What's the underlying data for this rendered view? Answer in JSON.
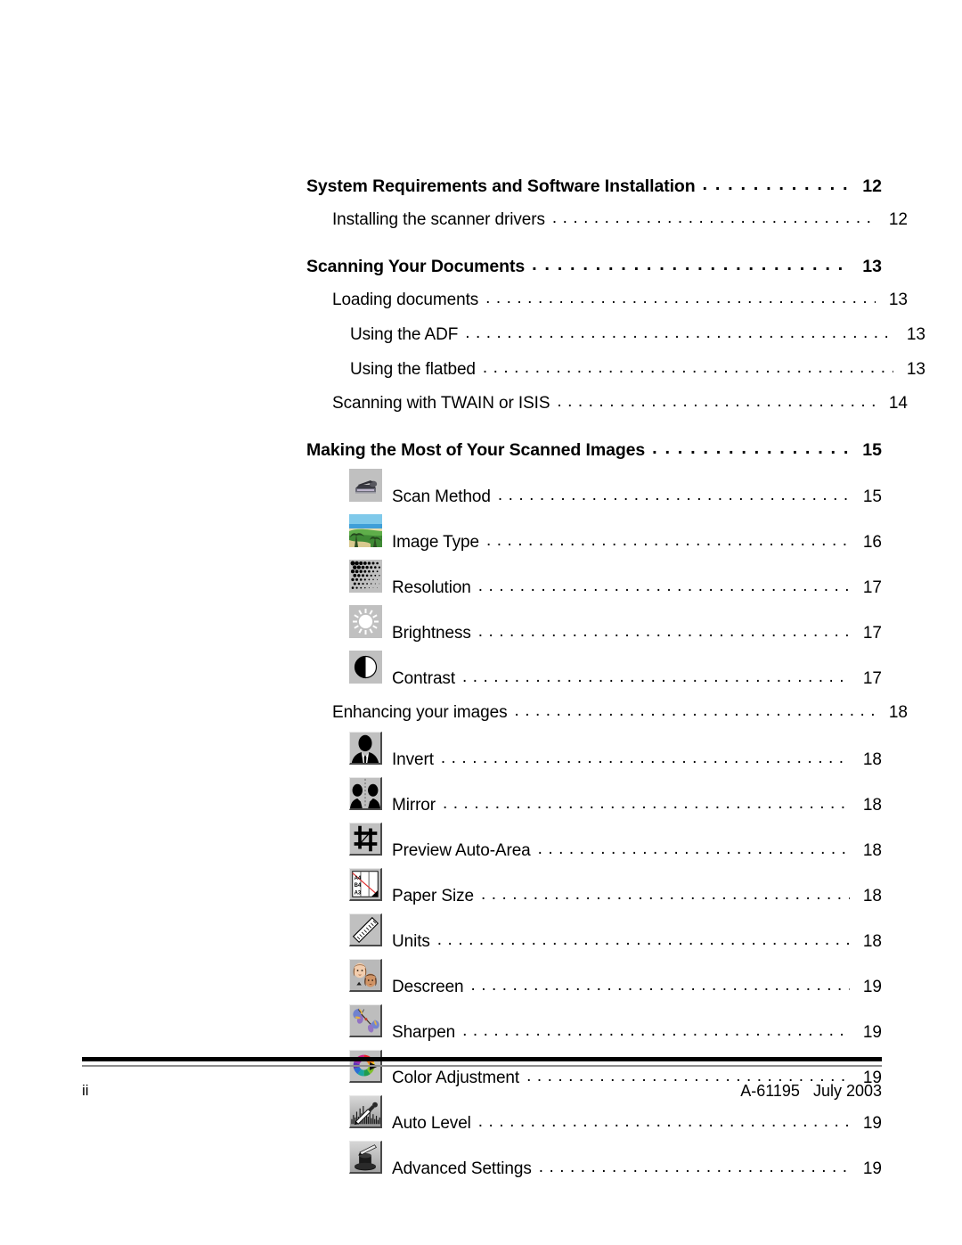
{
  "document": {
    "type": "table-of-contents",
    "page_label": "ii",
    "footer_reference": "A-61195   July 2003"
  },
  "toc": {
    "entries": [
      {
        "level": 1,
        "label": "System Requirements and Software Installation",
        "page": "12",
        "icon": null
      },
      {
        "level": 2,
        "label": "Installing the scanner drivers",
        "page": "12",
        "icon": null
      },
      {
        "level": 1,
        "label": "Scanning Your Documents",
        "page": "13",
        "icon": null
      },
      {
        "level": 2,
        "label": "Loading documents",
        "page": "13",
        "icon": null
      },
      {
        "level": 3,
        "label": "Using the ADF",
        "page": "13",
        "icon": null
      },
      {
        "level": 3,
        "label": "Using the flatbed",
        "page": "13",
        "icon": null
      },
      {
        "level": 2,
        "label": "Scanning with TWAIN or ISIS",
        "page": "14",
        "icon": null
      },
      {
        "level": 1,
        "label": "Making the Most of Your Scanned Images",
        "page": "15",
        "icon": null
      },
      {
        "level": 4,
        "label": "Scan Method",
        "page": "15",
        "icon": "scanner-icon"
      },
      {
        "level": 4,
        "label": "Image Type",
        "page": "16",
        "icon": "landscape-photo-icon"
      },
      {
        "level": 4,
        "label": "Resolution",
        "page": "17",
        "icon": "halftone-dots-icon"
      },
      {
        "level": 4,
        "label": "Brightness",
        "page": "17",
        "icon": "sun-icon"
      },
      {
        "level": 4,
        "label": "Contrast",
        "page": "17",
        "icon": "half-circle-icon"
      },
      {
        "level": 2,
        "label": "Enhancing your images",
        "page": "18",
        "icon": null
      },
      {
        "level": 4,
        "label": "Invert",
        "page": "18",
        "icon": "silhouette-bust-icon"
      },
      {
        "level": 4,
        "label": "Mirror",
        "page": "18",
        "icon": "mirrored-busts-icon"
      },
      {
        "level": 4,
        "label": "Preview Auto-Area",
        "page": "18",
        "icon": "crop-tool-icon"
      },
      {
        "level": 4,
        "label": "Paper Size",
        "page": "18",
        "icon": "paper-sizes-icon"
      },
      {
        "level": 4,
        "label": "Units",
        "page": "18",
        "icon": "ruler-icon"
      },
      {
        "level": 4,
        "label": "Descreen",
        "page": "19",
        "icon": "two-faces-icon"
      },
      {
        "level": 4,
        "label": "Sharpen",
        "page": "19",
        "icon": "butterfly-icon"
      },
      {
        "level": 4,
        "label": "Color Adjustment",
        "page": "19",
        "icon": "color-wheel-icon"
      },
      {
        "level": 4,
        "label": "Auto Level",
        "page": "19",
        "icon": "eyedropper-histogram-icon"
      },
      {
        "level": 4,
        "label": "Advanced Settings",
        "page": "19",
        "icon": "magic-hat-icon"
      }
    ]
  },
  "paper_size_icon_labels": {
    "a4": "A4",
    "b4": "B4",
    "a3": "A3"
  },
  "colors": {
    "text": "#000000",
    "page_background": "#ffffff",
    "icon_background": "#c0c0c0",
    "footer_rule_dark": "#000000",
    "footer_rule_light": "#8c8c8c"
  }
}
